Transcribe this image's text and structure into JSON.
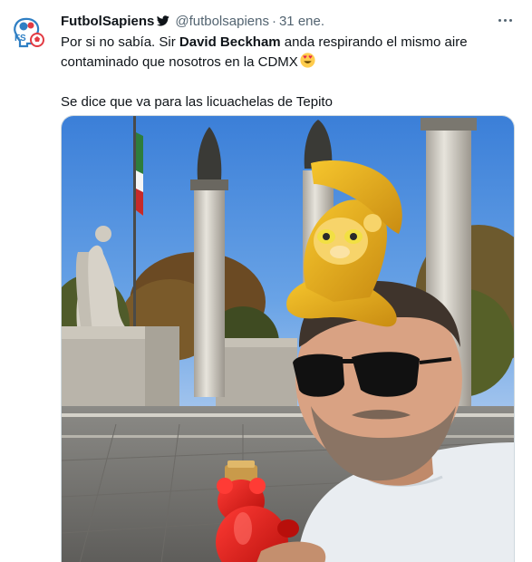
{
  "tweet": {
    "display_name": "FutbolSapiens",
    "handle": "@futbolsapiens",
    "separator": "·",
    "date": "31 ene.",
    "text_line1_pre": "Por si no sabía. Sir ",
    "text_line1_bold": "David Beckham",
    "text_line1_post": " anda respirando el mismo aire",
    "text_line2": "contaminado que nosotros en la CDMX",
    "text_line3": "Se dice que va para las licuachelas de Tepito"
  },
  "icons": {
    "avatar": "futbolsapiens-logo",
    "bird": "twitter-bird-icon",
    "emoji": "heart-eyes-emoji",
    "more": "more-horizontal-icon"
  },
  "colors": {
    "accent": "#1d9bf0",
    "text": "#0f1419",
    "secondary": "#536471",
    "logo_blue": "#2f7fc4",
    "logo_red": "#e23b43"
  }
}
